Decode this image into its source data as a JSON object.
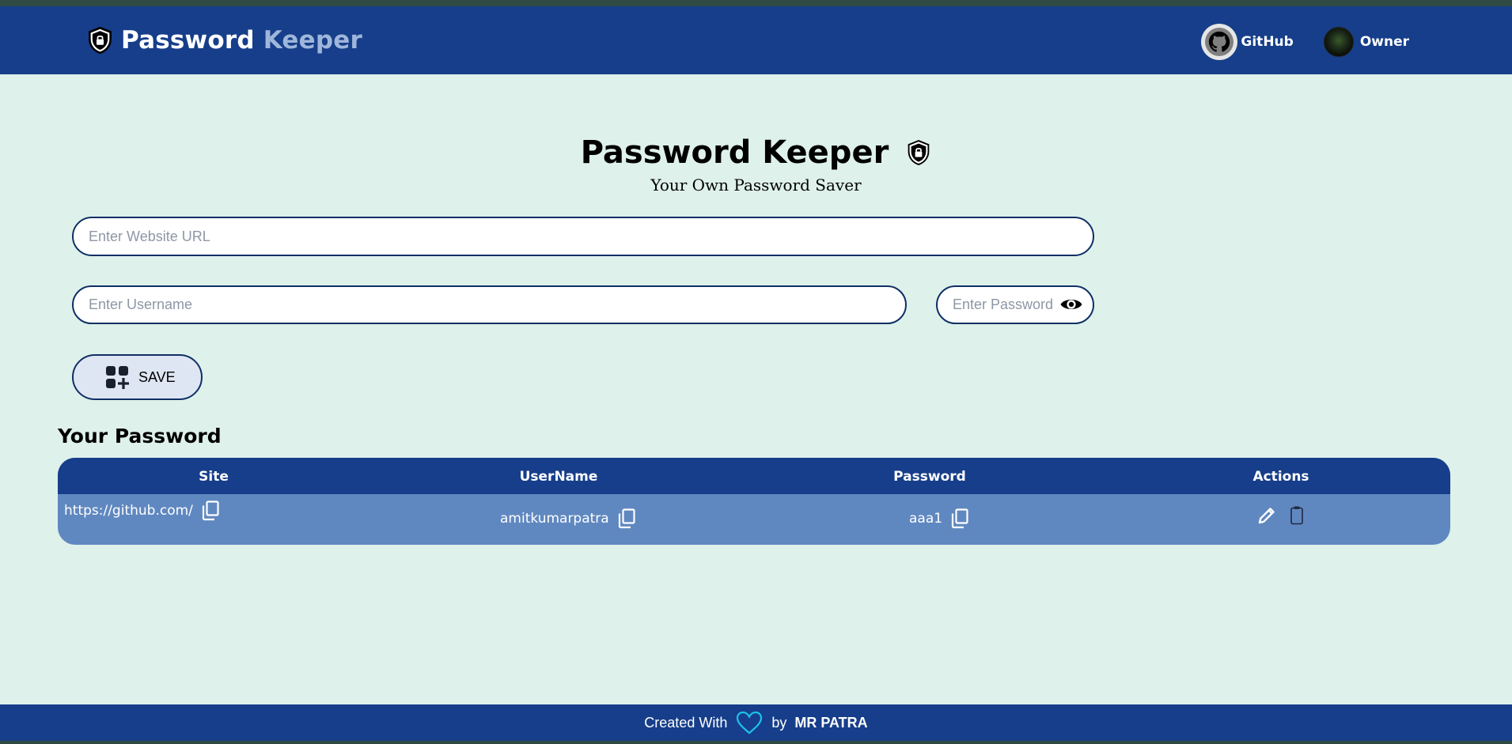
{
  "navbar": {
    "brand_part1": "Password",
    "brand_part2": "Keeper",
    "brand_icon": "shield-lock-icon",
    "github_label": "GitHub",
    "owner_label": "Owner"
  },
  "main": {
    "title": "Password Keeper",
    "subtitle": "Your Own Password Saver"
  },
  "form": {
    "url_placeholder": "Enter Website URL",
    "url_value": "",
    "username_placeholder": "Enter Username",
    "username_value": "",
    "password_placeholder": "Enter Password",
    "password_value": "",
    "save_label": "SAVE"
  },
  "passwords": {
    "section_title": "Your Password",
    "columns": [
      "Site",
      "UserName",
      "Password",
      "Actions"
    ],
    "rows": [
      {
        "site": "https://github.com/",
        "username": "amitkumarpatra",
        "password": "aaa1"
      }
    ]
  },
  "footer": {
    "created_with": "Created With",
    "by": "by",
    "author": "MR PATRA"
  },
  "colors": {
    "navbar_bg": "#163e8a",
    "page_bg": "#def1ea",
    "table_row_bg": "#6088c0",
    "brand_accent": "#9fb6db",
    "heart_color": "#1fc3e8"
  }
}
